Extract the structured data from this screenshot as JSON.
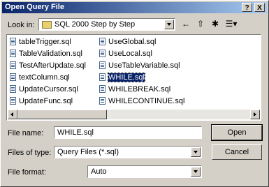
{
  "title": "Open Query File",
  "title_buttons": {
    "help": "?",
    "close": "X"
  },
  "lookin": {
    "label": "Look in:",
    "value": "SQL 2000 Step by Step"
  },
  "toolbar": {
    "back": "←",
    "up": "⇧",
    "newfolder": "✱",
    "views": "☰▾"
  },
  "files_col1": [
    "tableTrigger.sql",
    "TableValidation.sql",
    "TestAfterUpdate.sql",
    "textColumn.sql",
    "UpdateCursor.sql",
    "UpdateFunc.sql"
  ],
  "files_col2": [
    "UseGlobal.sql",
    "UseLocal.sql",
    "UseTableVariable.sql",
    "WHILE.sql",
    "WHILEBREAK.sql",
    "WHILECONTINUE.sql"
  ],
  "selected_file": "WHILE.sql",
  "filename": {
    "label": "File name:",
    "value": "WHILE.sql"
  },
  "filetype": {
    "label": "Files of type:",
    "value": "Query Files (*.sql)"
  },
  "fileformat": {
    "label": "File format:",
    "value": "Auto"
  },
  "buttons": {
    "open": "Open",
    "cancel": "Cancel"
  },
  "colors": {
    "titlebar_start": "#0a246a",
    "titlebar_end": "#a6caf0",
    "dialog_bg": "#d4d0c8",
    "selection": "#0a246a"
  }
}
